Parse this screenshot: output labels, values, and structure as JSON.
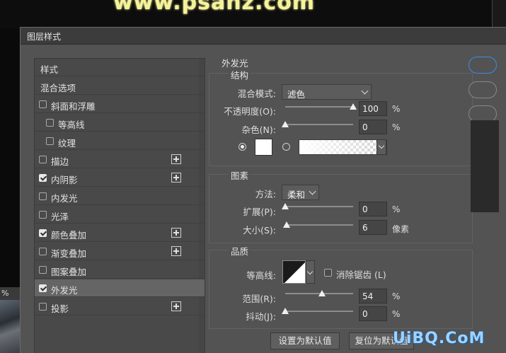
{
  "background": {
    "watermark": "www.psahz.com",
    "left_label": "%"
  },
  "dialog": {
    "title": "图层样式"
  },
  "style_list": [
    {
      "label": "样式",
      "checkbox": false,
      "checked": false,
      "plus": false
    },
    {
      "label": "混合选项",
      "checkbox": false,
      "checked": false,
      "plus": false
    },
    {
      "label": "斜面和浮雕",
      "checkbox": true,
      "checked": false,
      "plus": false
    },
    {
      "label": "等高线",
      "checkbox": true,
      "checked": false,
      "plus": false,
      "indent": true
    },
    {
      "label": "纹理",
      "checkbox": true,
      "checked": false,
      "plus": false,
      "indent": true
    },
    {
      "label": "描边",
      "checkbox": true,
      "checked": false,
      "plus": true
    },
    {
      "label": "内阴影",
      "checkbox": true,
      "checked": true,
      "plus": true
    },
    {
      "label": "内发光",
      "checkbox": true,
      "checked": false,
      "plus": false
    },
    {
      "label": "光泽",
      "checkbox": true,
      "checked": false,
      "plus": false
    },
    {
      "label": "颜色叠加",
      "checkbox": true,
      "checked": true,
      "plus": true
    },
    {
      "label": "渐变叠加",
      "checkbox": true,
      "checked": false,
      "plus": true
    },
    {
      "label": "图案叠加",
      "checkbox": true,
      "checked": false,
      "plus": false
    },
    {
      "label": "外发光",
      "checkbox": true,
      "checked": true,
      "plus": false,
      "active": true
    },
    {
      "label": "投影",
      "checkbox": true,
      "checked": false,
      "plus": true
    }
  ],
  "outer_glow": {
    "title": "外发光",
    "structure": {
      "title": "结构",
      "blend_mode_label": "混合模式:",
      "blend_mode_value": "滤色",
      "opacity_label": "不透明度(O):",
      "opacity_value": "100",
      "opacity_unit": "%",
      "opacity_level": 1.0,
      "noise_label": "杂色(N):",
      "noise_value": "0",
      "noise_unit": "%",
      "noise_level": 0.0,
      "glow_color": "#ffffff"
    },
    "elements": {
      "title": "图素",
      "technique_label": "方法:",
      "technique_value": "柔和",
      "spread_label": "扩展(P):",
      "spread_value": "0",
      "spread_unit": "%",
      "spread_level": 0.0,
      "size_label": "大小(S):",
      "size_value": "6",
      "size_unit": "像素",
      "size_level": 0.024
    },
    "quality": {
      "title": "品质",
      "contour_label": "等高线:",
      "anti_alias_label": "消除锯齿 (L)",
      "range_label": "范围(R):",
      "range_value": "54",
      "range_unit": "%",
      "range_level": 0.54,
      "jitter_label": "抖动(J):",
      "jitter_value": "0",
      "jitter_unit": "%",
      "jitter_level": 0.0
    },
    "buttons": {
      "set_default": "设置为默认值",
      "reset_default": "复位为默认值"
    }
  },
  "corner_watermark": "UiBQ.CoM"
}
